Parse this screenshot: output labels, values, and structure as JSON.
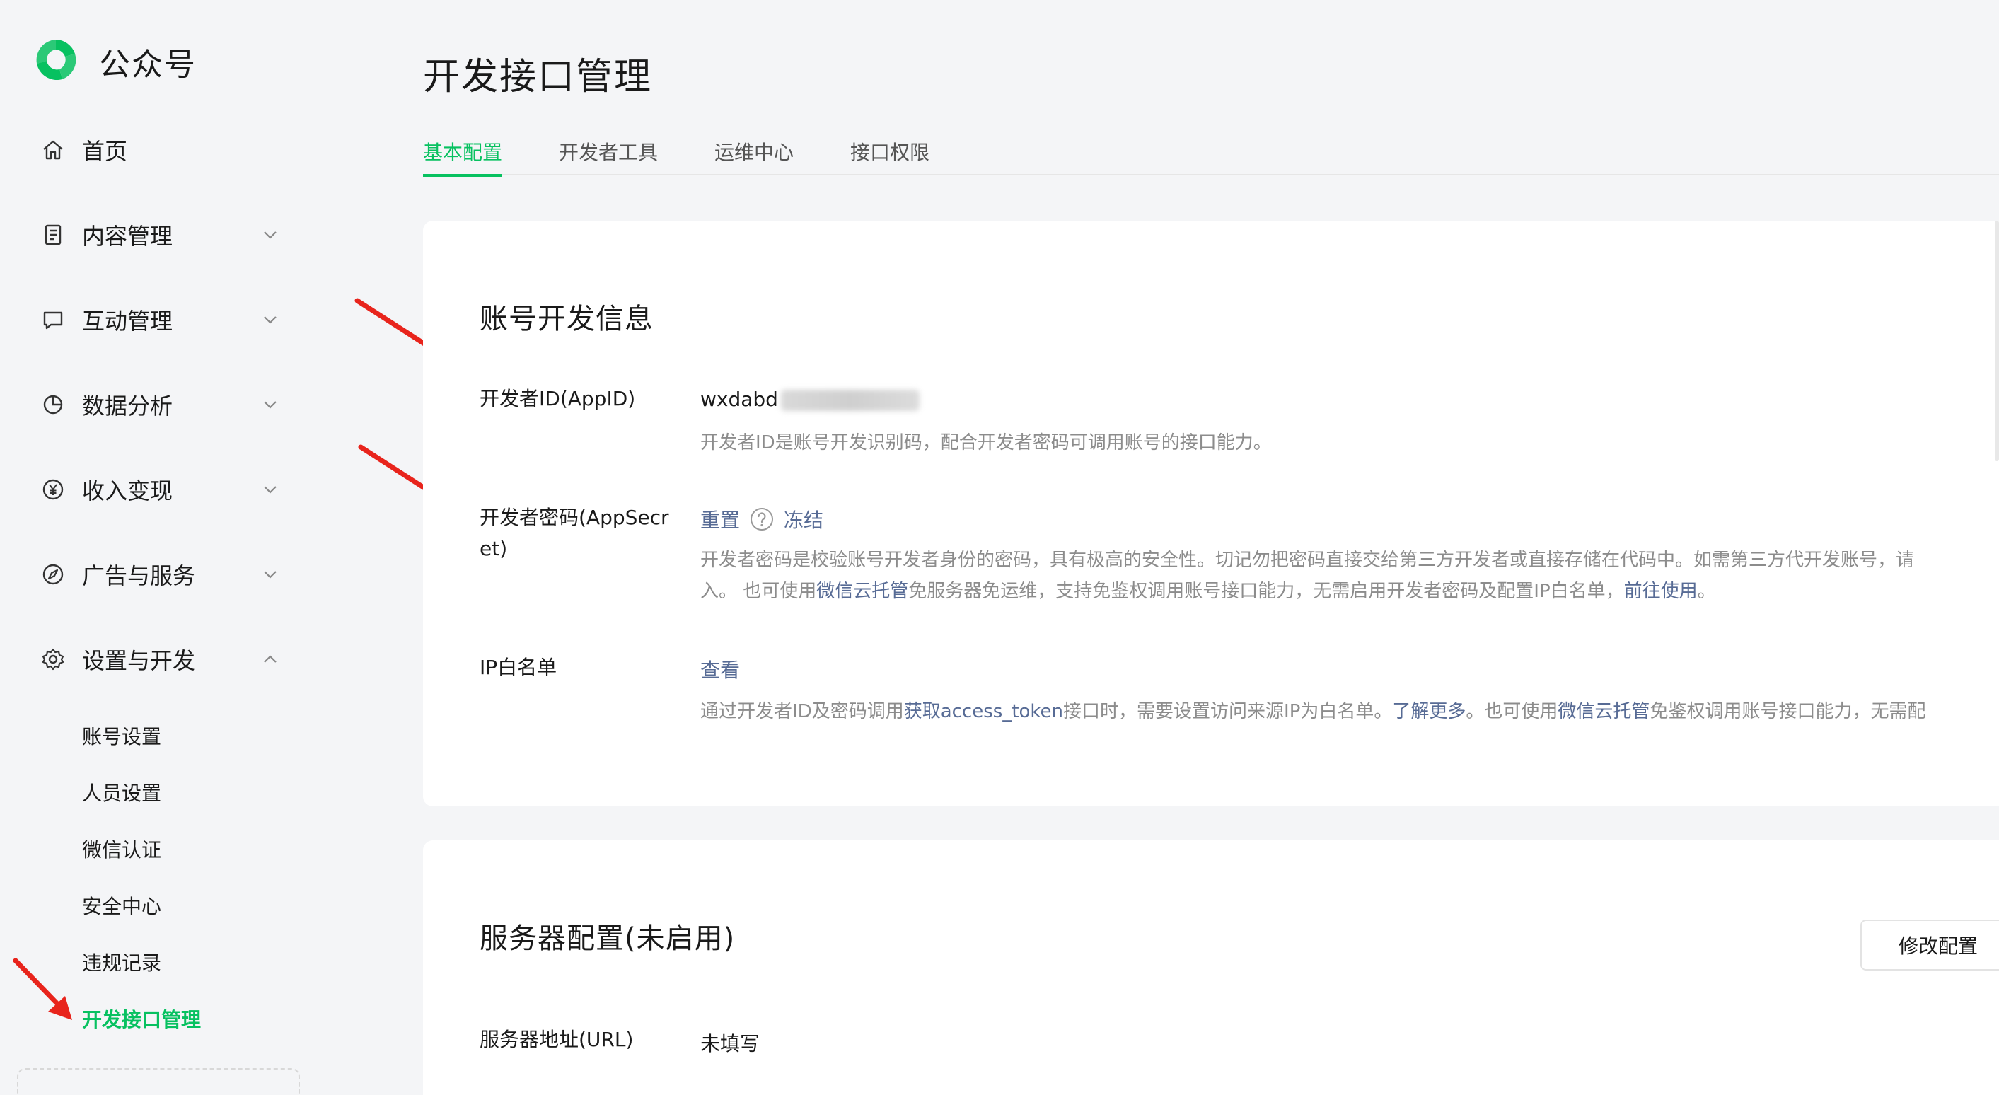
{
  "app": {
    "logo_text": "公众号"
  },
  "sidebar": {
    "items": [
      {
        "label": "首页",
        "icon": "home-icon"
      },
      {
        "label": "内容管理",
        "icon": "document-icon",
        "expandable": true
      },
      {
        "label": "互动管理",
        "icon": "chat-icon",
        "expandable": true
      },
      {
        "label": "数据分析",
        "icon": "pie-chart-icon",
        "expandable": true
      },
      {
        "label": "收入变现",
        "icon": "yen-icon",
        "expandable": true
      },
      {
        "label": "广告与服务",
        "icon": "compass-icon",
        "expandable": true
      },
      {
        "label": "设置与开发",
        "icon": "gear-icon",
        "expandable": true,
        "expanded": true
      }
    ],
    "sub_items": [
      {
        "label": "账号设置"
      },
      {
        "label": "人员设置"
      },
      {
        "label": "微信认证"
      },
      {
        "label": "安全中心"
      },
      {
        "label": "违规记录"
      },
      {
        "label": "开发接口管理",
        "active": true
      }
    ]
  },
  "main": {
    "title": "开发接口管理",
    "tabs": [
      {
        "label": "基本配置",
        "active": true
      },
      {
        "label": "开发者工具"
      },
      {
        "label": "运维中心"
      },
      {
        "label": "接口权限"
      }
    ],
    "account_section": {
      "title": "账号开发信息",
      "appid_label": "开发者ID(AppID)",
      "appid_value": "wxdabd",
      "appid_desc": "开发者ID是账号开发识别码，配合开发者密码可调用账号的接口能力。",
      "secret_label": "开发者密码(AppSecret)",
      "secret_reset": "重置",
      "secret_freeze": "冻结",
      "secret_desc_line1": "开发者密码是校验账号开发者身份的密码，具有极高的安全性。切记勿把密码直接交给第三方开发者或直接存储在代码中。如需第三方代开发账号，请",
      "secret_desc_line2_a": "入。 也可使用",
      "secret_desc_line2_link1": "微信云托管",
      "secret_desc_line2_b": "免服务器免运维，支持免鉴权调用账号接口能力，无需启用开发者密码及配置IP白名单，",
      "secret_desc_line2_link2": "前往使用",
      "secret_desc_line2_c": "。",
      "ip_label": "IP白名单",
      "ip_view": "查看",
      "ip_desc_a": "通过开发者ID及密码调用",
      "ip_desc_link1": "获取access_token",
      "ip_desc_b": "接口时，需要设置访问来源IP为白名单。",
      "ip_desc_link2": "了解更多",
      "ip_desc_c": "。也可使用",
      "ip_desc_link3": "微信云托管",
      "ip_desc_d": "免鉴权调用账号接口能力，无需配"
    },
    "server_section": {
      "title": "服务器配置(未启用)",
      "modify_button": "修改配置",
      "url_label": "服务器地址(URL)",
      "url_value": "未填写"
    }
  },
  "colors": {
    "accent": "#07c160",
    "link": "#576b95",
    "arrow": "#e8241c"
  }
}
